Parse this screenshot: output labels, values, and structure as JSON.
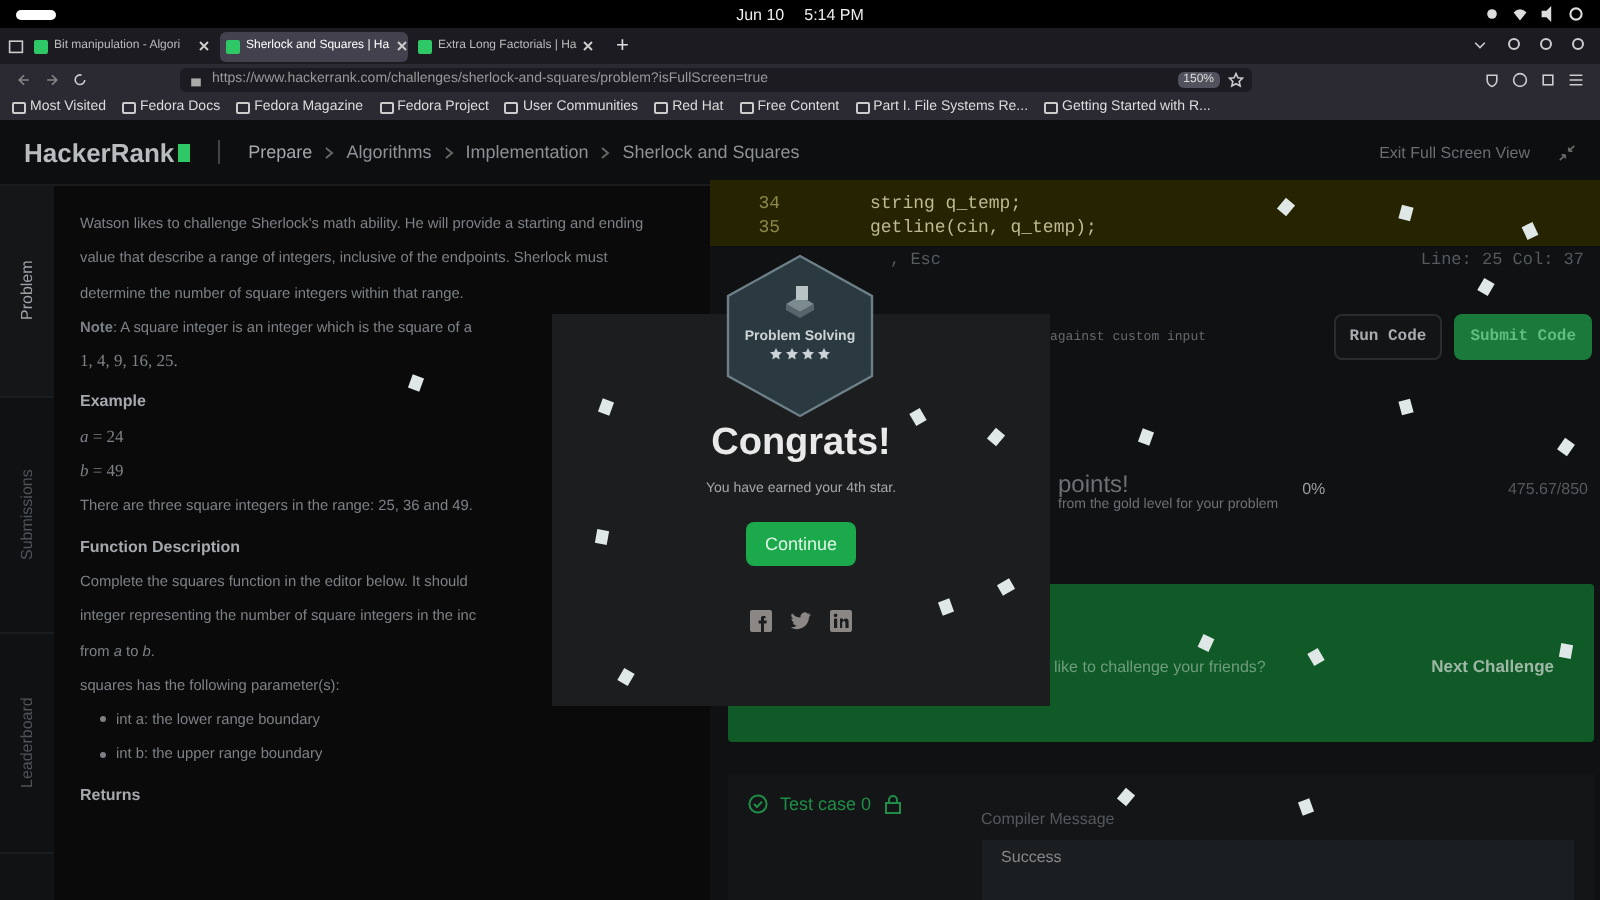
{
  "system_bar": {
    "date": "Jun 10",
    "time": "5:14 PM"
  },
  "browser": {
    "tabs": [
      {
        "title": "Bit manipulation - Algori",
        "selected": false
      },
      {
        "title": "Sherlock and Squares | Ha",
        "selected": true
      },
      {
        "title": "Extra Long Factorials | Ha",
        "selected": false
      }
    ],
    "new_tab": "+",
    "url": "https://www.hackerrank.com/challenges/sherlock-and-squares/problem?isFullScreen=true",
    "zoom": "150%",
    "bookmarks": [
      "Most Visited",
      "Fedora Docs",
      "Fedora Magazine",
      "Fedora Project",
      "User Communities",
      "Red Hat",
      "Free Content",
      "Part I. File Systems Re...",
      "Getting Started with R..."
    ]
  },
  "header": {
    "logo": "HackerRank",
    "breadcrumb": [
      "Prepare",
      "Algorithms",
      "Implementation",
      "Sherlock and Squares"
    ],
    "exit_link": "Exit Full Screen View"
  },
  "side_tabs": [
    {
      "label": "Problem",
      "selected": true
    },
    {
      "label": "Submissions",
      "selected": false
    },
    {
      "label": "Leaderboard",
      "selected": false
    }
  ],
  "problem": {
    "intro": "Watson likes to challenge Sherlock's math ability. He will provide a starting and ending value that describe a range of integers, inclusive of the endpoints. Sherlock must determine the number of square integers within that range.",
    "note": "**Note**: A square integer is an integer which is the square of a",
    "note_values": "1, 4, 9, 16, 25.",
    "example_heading": "Example",
    "example_lines": [
      "*a* = 24",
      "*b* = 49"
    ],
    "explanation": "There are three square integers in the range: 25, 36 and 49.",
    "function_heading": "Function Description",
    "function_lines": [
      "Complete the squares function in the editor below. It should",
      "integer representing the number of square integers in the inc",
      "from *a* to *b*."
    ],
    "parameters_intro": "squares has the following parameter(s):",
    "parameters": [
      "int a: the lower range boundary",
      "int b: the upper range boundary"
    ],
    "returns_heading": "Returns"
  },
  "editor": {
    "lines": [
      {
        "number": "34",
        "code": "string q_temp;"
      },
      {
        "number": "35",
        "code": "getline(cin, q_temp);"
      }
    ],
    "hint": ", Esc",
    "cursor": "Line: 25 Col: 37",
    "custom_input": "against custom input",
    "buttons": [
      {
        "label": "Run Code",
        "kind": "secondary"
      },
      {
        "label": "Submit Code",
        "kind": "primary"
      }
    ]
  },
  "points": {
    "title": "points!",
    "subtitle": "from the gold level for your problem",
    "percent": "0%",
    "score": "475.67/850"
  },
  "share_panel": {
    "text": "like to challenge your friends?",
    "next": "Next Challenge"
  },
  "test_case": {
    "label": "Test case 0",
    "compiler_label": "Compiler Message",
    "message": "Success"
  },
  "modal": {
    "badge": {
      "title": "Problem Solving",
      "stars": 4
    },
    "heading": "Congrats!",
    "message": "You have earned your 4th star.",
    "button": "Continue"
  }
}
